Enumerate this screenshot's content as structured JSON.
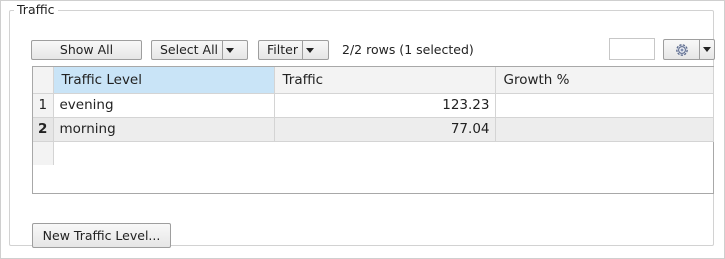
{
  "group": {
    "title": "Traffic"
  },
  "toolbar": {
    "show_all_label": "Show All",
    "select_all_label": "Select All",
    "filter_label": "Filter",
    "row_status": "2/2 rows (1 selected)",
    "settings_icon": "gear-icon"
  },
  "table": {
    "columns": [
      "Traffic Level",
      "Traffic",
      "Growth %"
    ],
    "rows": [
      {
        "num": "1",
        "level": "evening",
        "traffic": "123.23",
        "growth": ""
      },
      {
        "num": "2",
        "level": "morning",
        "traffic": "77.04",
        "growth": ""
      }
    ],
    "selected_row": 2
  },
  "actions": {
    "new_label": "New Traffic Level..."
  },
  "colors": {
    "selected_header": "#c9e4f7",
    "selected_row": "#ededed",
    "border": "#a8a8a8"
  }
}
